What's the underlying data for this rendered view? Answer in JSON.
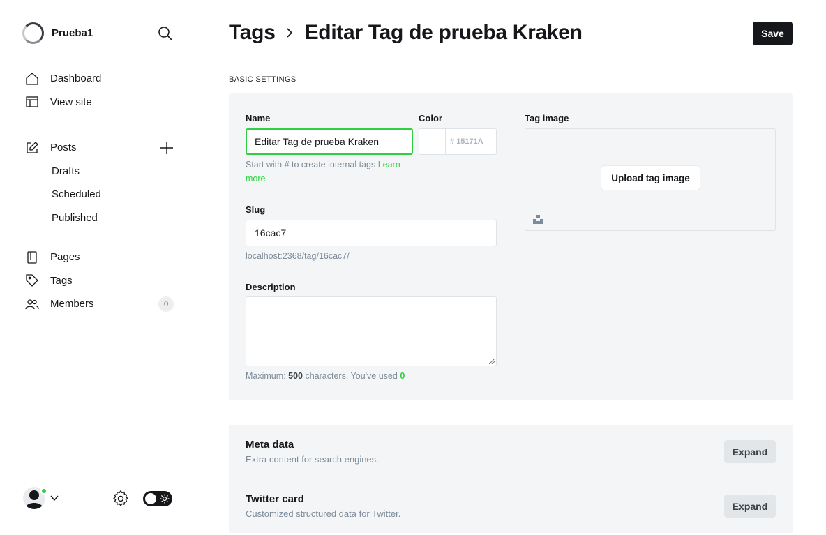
{
  "site": {
    "name": "Prueba1"
  },
  "nav": {
    "dashboard": "Dashboard",
    "view_site": "View site",
    "posts": "Posts",
    "drafts": "Drafts",
    "scheduled": "Scheduled",
    "published": "Published",
    "pages": "Pages",
    "tags": "Tags",
    "members": "Members",
    "members_count": "0"
  },
  "header": {
    "crumb_parent": "Tags",
    "title": "Editar Tag de prueba Kraken",
    "save": "Save"
  },
  "basic": {
    "section_label": "BASIC SETTINGS",
    "name_label": "Name",
    "name_value": "Editar Tag de prueba Kraken",
    "name_hint": "Start with # to create internal tags",
    "learn": "Learn",
    "more": "more",
    "color_label": "Color",
    "color_hex": "15171A",
    "slug_label": "Slug",
    "slug_value": "16cac7",
    "slug_url": "localhost:2368/tag/16cac7/",
    "desc_label": "Description",
    "desc_value": "",
    "desc_hint_prefix": "Maximum:",
    "desc_max": "500",
    "desc_hint_mid": "characters. You've used",
    "desc_used": "0",
    "image_label": "Tag image",
    "upload": "Upload tag image"
  },
  "sections": [
    {
      "title": "Meta data",
      "subtitle": "Extra content for search engines.",
      "button": "Expand"
    },
    {
      "title": "Twitter card",
      "subtitle": "Customized structured data for Twitter.",
      "button": "Expand"
    }
  ],
  "colors": {
    "accent": "#30cf43",
    "dark": "#15171a",
    "panel": "#f4f5f6"
  }
}
